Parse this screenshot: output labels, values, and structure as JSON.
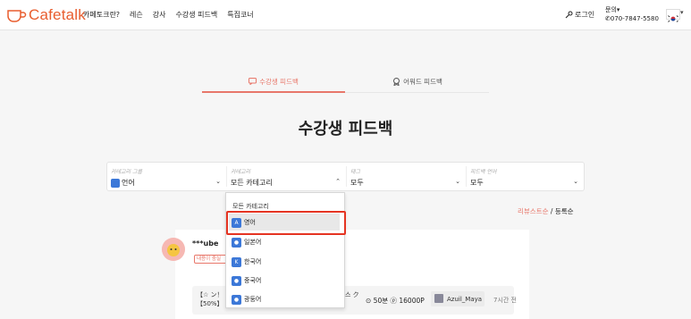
{
  "header": {
    "logo_text": "Cafetalk",
    "nav": [
      "카페토크란?",
      "레슨",
      "강사",
      "수강생 피드백",
      "특집코너"
    ],
    "login": "로그인",
    "contact_label": "문의▾",
    "contact_phone": "070-7847-5580",
    "flag": "KR"
  },
  "tabs": [
    {
      "label": "수강생 피드백",
      "active": true,
      "icon": "message-icon"
    },
    {
      "label": "어워드 피드백",
      "active": false,
      "icon": "award-icon"
    }
  ],
  "page_title": "수강생 피드백",
  "filters": [
    {
      "label": "카테고리 그룹",
      "value": "언어",
      "open": false,
      "icon": "language-icon"
    },
    {
      "label": "카테고리",
      "value": "모든 카테고리",
      "open": true
    },
    {
      "label": "태그",
      "value": "모두",
      "open": false
    },
    {
      "label": "피드백 언어",
      "value": "모두",
      "open": false
    }
  ],
  "sort": {
    "option_a": "리뷰스트순",
    "divider": "/",
    "option_b": "등록순"
  },
  "dropdown": {
    "header": "모든 카테고리",
    "items": [
      {
        "label": "영어",
        "icon": "A",
        "selected": true
      },
      {
        "label": "일본어",
        "icon": "●"
      },
      {
        "label": "한국어",
        "icon": "K"
      },
      {
        "label": "중국어",
        "icon": "●"
      },
      {
        "label": "광둥어",
        "icon": "●"
      }
    ]
  },
  "review": {
    "user": "***ube",
    "badge": "내용이 충실",
    "lesson_title": "【☆ ン！【50%】",
    "lesson_title_tail": "스 ク",
    "price": "⊙ 50분 ⓟ 16000P",
    "teacher": "Azuil_Maya",
    "time": "7시간 전"
  },
  "colors": {
    "accent": "#e8776a",
    "logo": "#e85d2e",
    "highlight": "#e53422",
    "category_icon": "#3c78d8"
  }
}
